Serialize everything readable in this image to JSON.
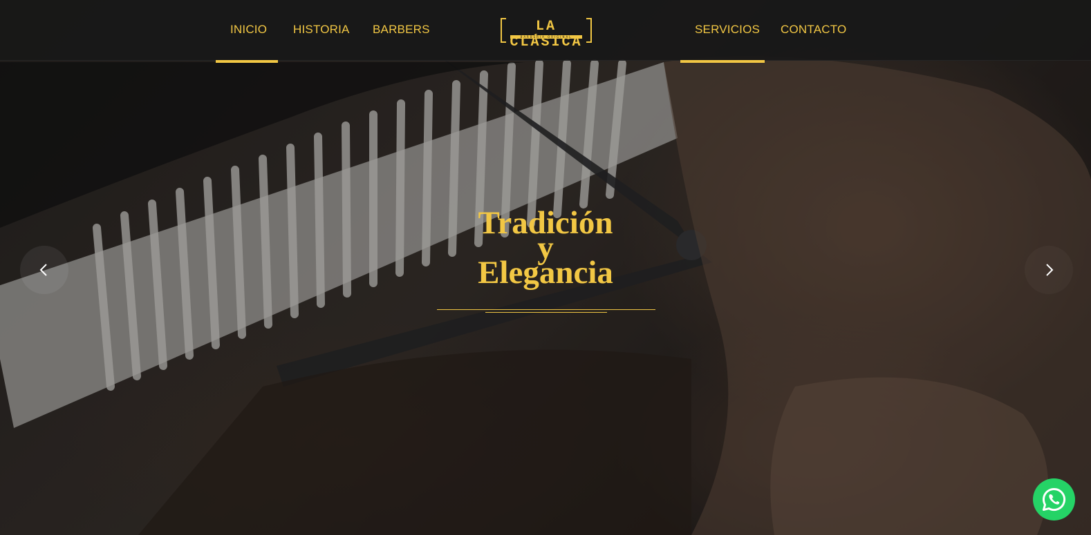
{
  "nav": {
    "left_items": [
      {
        "label": "INICIO",
        "active": true
      },
      {
        "label": "HISTORIA",
        "active": false
      },
      {
        "label": "BARBERS",
        "active": false
      }
    ],
    "right_items": [
      {
        "label": "SERVICIOS",
        "active": true
      },
      {
        "label": "CONTACTO",
        "active": false
      }
    ],
    "logo": {
      "text": "LA CLÁSICA",
      "subtitle": "BARBERIA ORIGINAL"
    }
  },
  "hero": {
    "title_lines": [
      "Tradición",
      "y",
      "Elegancia"
    ],
    "prev_icon": "chevron-left-icon",
    "next_icon": "chevron-right-icon"
  },
  "whatsapp": {
    "icon": "whatsapp-icon"
  },
  "colors": {
    "accent": "#f2c744",
    "nav_background": "#181818",
    "whatsapp": "#25d366"
  }
}
